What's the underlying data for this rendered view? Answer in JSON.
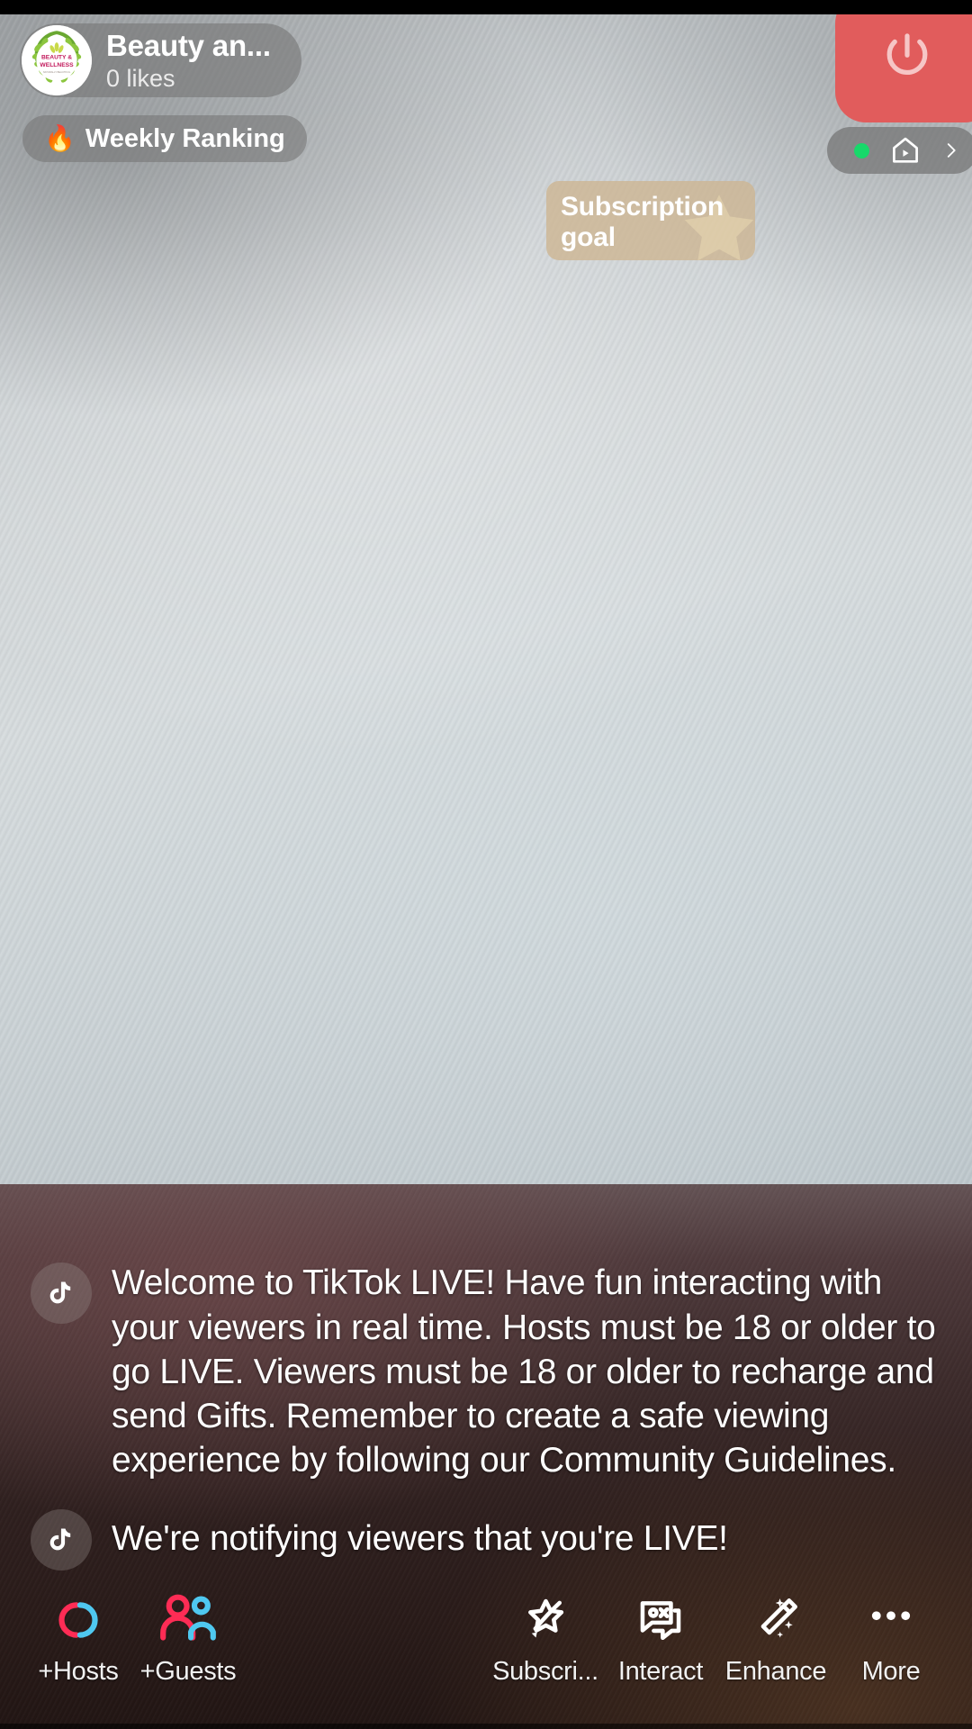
{
  "app": {
    "name": "TikTok LIVE",
    "screen": "live-host-broadcast"
  },
  "header": {
    "host": {
      "avatar_icon": "beauty-wellness-logo",
      "avatar_text_line1": "BEAUTY &",
      "avatar_text_line2": "WELLNESS",
      "name": "Beauty an...",
      "likes": "0 likes"
    },
    "weekly_ranking": {
      "icon": "flame-icon",
      "emoji": "🔥",
      "label": "Weekly Ranking"
    },
    "end_live": {
      "icon": "power-icon",
      "label": "",
      "color": "#e15c5c"
    },
    "live_status": {
      "dot_color": "#17d96a",
      "house_icon": "house-play-icon",
      "chevron_icon": "chevron-right-icon"
    }
  },
  "overlays": {
    "subscription_goal": {
      "title": "Subscription goal",
      "icon": "star-icon",
      "background": "#cdb592"
    }
  },
  "chat": {
    "messages": [
      {
        "avatar_icon": "tiktok-note-icon",
        "text": "Welcome to TikTok LIVE! Have fun interacting with your viewers in real time. Hosts must be 18 or older to go LIVE. Viewers must be 18 or older to recharge and send Gifts. Remember to create a safe viewing experience by following our Community Guidelines."
      },
      {
        "avatar_icon": "tiktok-note-icon",
        "text": "We're notifying viewers that you're LIVE!"
      }
    ]
  },
  "toolbar": {
    "items": [
      {
        "id": "hosts",
        "label": "+Hosts",
        "icon": "linked-rings-icon"
      },
      {
        "id": "guests",
        "label": "+Guests",
        "icon": "two-people-icon"
      },
      {
        "id": "subscri",
        "label": "Subscri...",
        "icon": "shooting-star-icon"
      },
      {
        "id": "interact",
        "label": "Interact",
        "icon": "chat-ox-icon"
      },
      {
        "id": "enhance",
        "label": "Enhance",
        "icon": "magic-wand-icon"
      },
      {
        "id": "more",
        "label": "More",
        "icon": "ellipsis-icon"
      }
    ]
  },
  "colors": {
    "accent_pink": "#fe2c55",
    "accent_blue": "#4fc8f0",
    "end_live_red": "#e15c5c",
    "live_green": "#17d96a",
    "goal_tan": "#cdb592"
  }
}
